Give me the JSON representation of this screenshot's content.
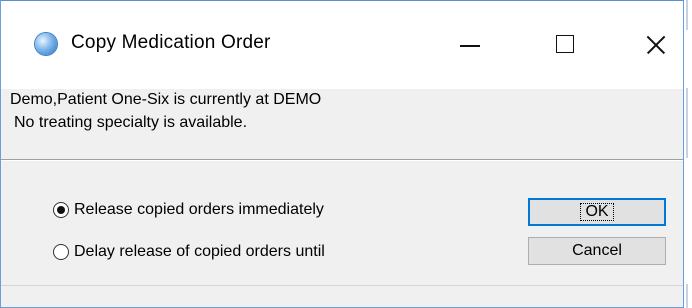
{
  "window": {
    "title": "Copy Medication Order",
    "icon": "app-globe-icon",
    "controls": [
      "minimize",
      "maximize",
      "close"
    ]
  },
  "info": {
    "line1": "Demo,Patient One-Six is currently at DEMO",
    "line2": "No treating specialty is available."
  },
  "options": {
    "release_now": {
      "label": "Release copied orders immediately",
      "selected": true
    },
    "delay_release": {
      "label": "Delay release of copied orders until",
      "selected": false
    }
  },
  "buttons": {
    "ok": "OK",
    "cancel": "Cancel"
  },
  "colors": {
    "focus_border": "#0078d7",
    "dialog_bg": "#f0f0f0"
  }
}
